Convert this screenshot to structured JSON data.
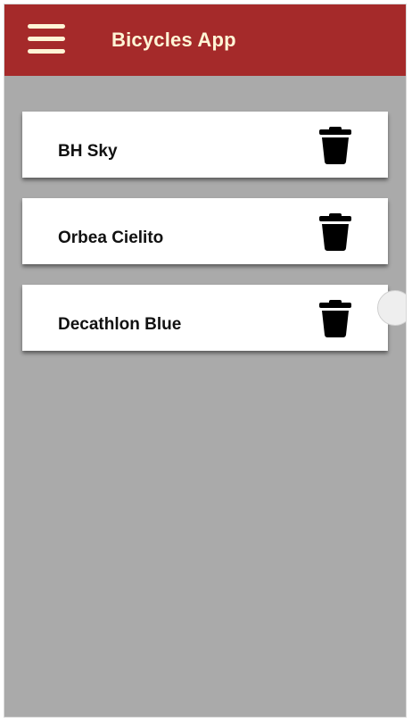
{
  "header": {
    "title": "Bicycles App",
    "menu_icon": "hamburger-menu-icon",
    "background_color": "#a52a2a",
    "text_color": "#fff5d6"
  },
  "list": {
    "items": [
      {
        "label": "BH Sky",
        "action_icon": "trash-icon"
      },
      {
        "label": "Orbea Cielito",
        "action_icon": "trash-icon"
      },
      {
        "label": "Decathlon Blue",
        "action_icon": "trash-icon"
      }
    ]
  },
  "colors": {
    "page_background": "#aaaaaa",
    "card_background": "#ffffff"
  }
}
